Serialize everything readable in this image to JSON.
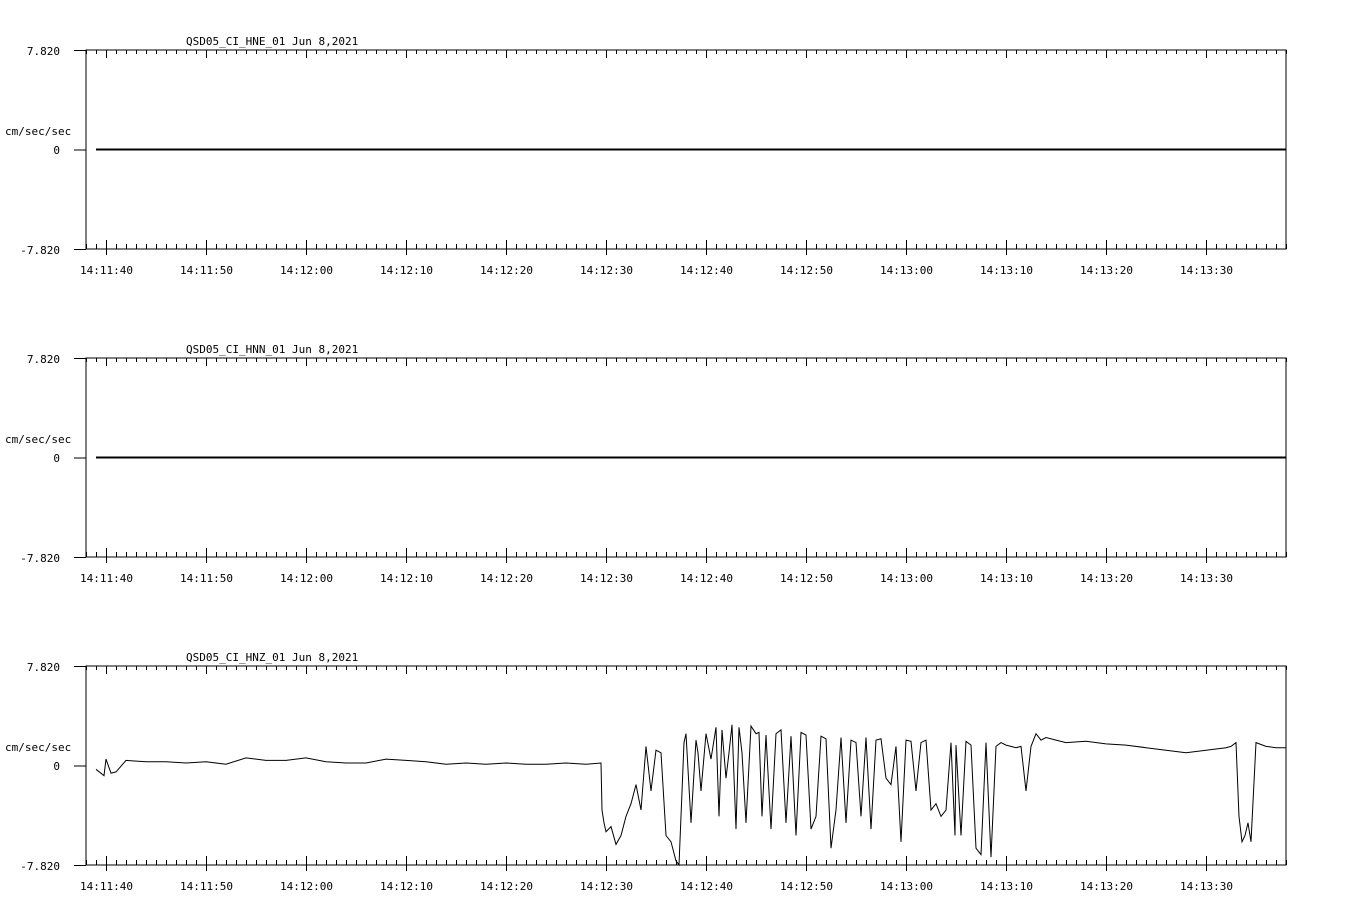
{
  "chart_data": [
    {
      "type": "line",
      "title": "QSD05_CI_HNE_01  Jun 8,2021",
      "ylabel": "cm/sec/sec",
      "ylim": [
        -7.82,
        7.82
      ],
      "ytick_labels": [
        "7.820",
        "0",
        "-7.820"
      ],
      "x_start": "14:11:38",
      "x_end": "14:13:38",
      "x_ticks": [
        "14:11:40",
        "14:11:50",
        "14:12:00",
        "14:12:10",
        "14:12:20",
        "14:12:30",
        "14:12:40",
        "14:12:50",
        "14:13:00",
        "14:13:10",
        "14:13:20",
        "14:13:30"
      ],
      "series": [
        {
          "t": [
            1,
            120
          ],
          "y": [
            0,
            0
          ]
        }
      ]
    },
    {
      "type": "line",
      "title": "QSD05_CI_HNN_01  Jun 8,2021",
      "ylabel": "cm/sec/sec",
      "ylim": [
        -7.82,
        7.82
      ],
      "ytick_labels": [
        "7.820",
        "0",
        "-7.820"
      ],
      "x_start": "14:11:38",
      "x_end": "14:13:38",
      "x_ticks": [
        "14:11:40",
        "14:11:50",
        "14:12:00",
        "14:12:10",
        "14:12:20",
        "14:12:30",
        "14:12:40",
        "14:12:50",
        "14:13:00",
        "14:13:10",
        "14:13:20",
        "14:13:30"
      ],
      "series": [
        {
          "t": [
            1,
            120
          ],
          "y": [
            0,
            0
          ]
        }
      ]
    },
    {
      "type": "line",
      "title": "QSD05_CI_HNZ_01  Jun 8,2021",
      "ylabel": "cm/sec/sec",
      "ylim": [
        -7.82,
        7.82
      ],
      "ytick_labels": [
        "7.820",
        "0",
        "-7.820"
      ],
      "x_start": "14:11:38",
      "x_end": "14:13:38",
      "x_ticks": [
        "14:11:40",
        "14:11:50",
        "14:12:00",
        "14:12:10",
        "14:12:20",
        "14:12:30",
        "14:12:40",
        "14:12:50",
        "14:13:00",
        "14:13:10",
        "14:13:20",
        "14:13:30"
      ],
      "series": [
        {
          "t": [
            1,
            1.8,
            2,
            2.5,
            3,
            4,
            6,
            8,
            10,
            12,
            14,
            16,
            18,
            20,
            22,
            24,
            26,
            28,
            30,
            32,
            34,
            36,
            38,
            40,
            42,
            44,
            46,
            48,
            50,
            51.5,
            51.6,
            51.8,
            52,
            52.5,
            53,
            53.5,
            54,
            54.5,
            55,
            55.5,
            56,
            56.5,
            57,
            57.5,
            58,
            58.5,
            59,
            59.3,
            59.5,
            59.8,
            60,
            60.5,
            61,
            61.2,
            61.5,
            62,
            62.5,
            63,
            63.3,
            63.6,
            64,
            64.3,
            64.6,
            65,
            65.3,
            65.6,
            66,
            66.5,
            67,
            67.3,
            67.6,
            68,
            68.5,
            69,
            69.5,
            70,
            70.5,
            71,
            71.5,
            72,
            72.5,
            73,
            73.5,
            74,
            74.5,
            75,
            75.5,
            76,
            76.5,
            77,
            77.5,
            78,
            78.5,
            79,
            79.5,
            80,
            80.5,
            81,
            81.5,
            82,
            82.5,
            83,
            83.5,
            84,
            84.5,
            85,
            85.5,
            86,
            86.5,
            86.9,
            87,
            87.5,
            88,
            88.5,
            89,
            89.5,
            90,
            90.5,
            91,
            91.5,
            92,
            92.5,
            93,
            93.5,
            94,
            94.5,
            95,
            95.5,
            96,
            97,
            98,
            100,
            102,
            104,
            106,
            108,
            110,
            112,
            114,
            114.5,
            115,
            115.3,
            115.6,
            115.9,
            116.2,
            116.5,
            117,
            118,
            119,
            120
          ],
          "y": [
            -0.3,
            -0.8,
            0.5,
            -0.6,
            -0.5,
            0.4,
            0.3,
            0.3,
            0.2,
            0.3,
            0.1,
            0.6,
            0.4,
            0.4,
            0.6,
            0.3,
            0.2,
            0.2,
            0.5,
            0.4,
            0.3,
            0.1,
            0.2,
            0.1,
            0.2,
            0.1,
            0.1,
            0.2,
            0.1,
            0.2,
            -3.5,
            -4.5,
            -5.2,
            -4.8,
            -6.2,
            -5.5,
            -4.0,
            -3.0,
            -1.5,
            -3.5,
            1.5,
            -2.0,
            1.2,
            1.0,
            -5.5,
            -6.0,
            -7.5,
            -7.8,
            -4.0,
            1.8,
            2.5,
            -4.5,
            2.0,
            1.0,
            -2.0,
            2.5,
            0.5,
            3.0,
            -4.0,
            2.8,
            -1.0,
            1.0,
            3.2,
            -5.0,
            3.0,
            1.0,
            -4.5,
            3.1,
            2.5,
            2.6,
            -4.0,
            2.4,
            -5.0,
            2.5,
            2.8,
            -4.5,
            2.3,
            -5.5,
            2.6,
            2.4,
            -5.0,
            -4.0,
            2.3,
            2.1,
            -6.5,
            -3.5,
            2.2,
            -4.5,
            2.0,
            1.8,
            -4.0,
            2.2,
            -5.0,
            2.0,
            2.1,
            -1.0,
            -1.5,
            1.5,
            -6.0,
            2.0,
            1.9,
            -2.0,
            1.8,
            2.0,
            -3.5,
            -3.0,
            -4.0,
            -3.5,
            1.8,
            -5.5,
            1.6,
            -5.5,
            1.9,
            1.6,
            -6.5,
            -7.0,
            1.8,
            -7.2,
            1.5,
            1.8,
            1.6,
            1.5,
            1.4,
            1.5,
            -2.0,
            1.5,
            2.5,
            2.0,
            2.2,
            2.0,
            1.8,
            1.9,
            1.7,
            1.6,
            1.4,
            1.2,
            1.0,
            1.2,
            1.4,
            1.5,
            1.8,
            -4.0,
            -6.0,
            -5.5,
            -4.5,
            -6.0,
            1.8,
            1.5,
            1.4,
            1.4,
            1.2,
            0.9
          ]
        }
      ]
    }
  ]
}
